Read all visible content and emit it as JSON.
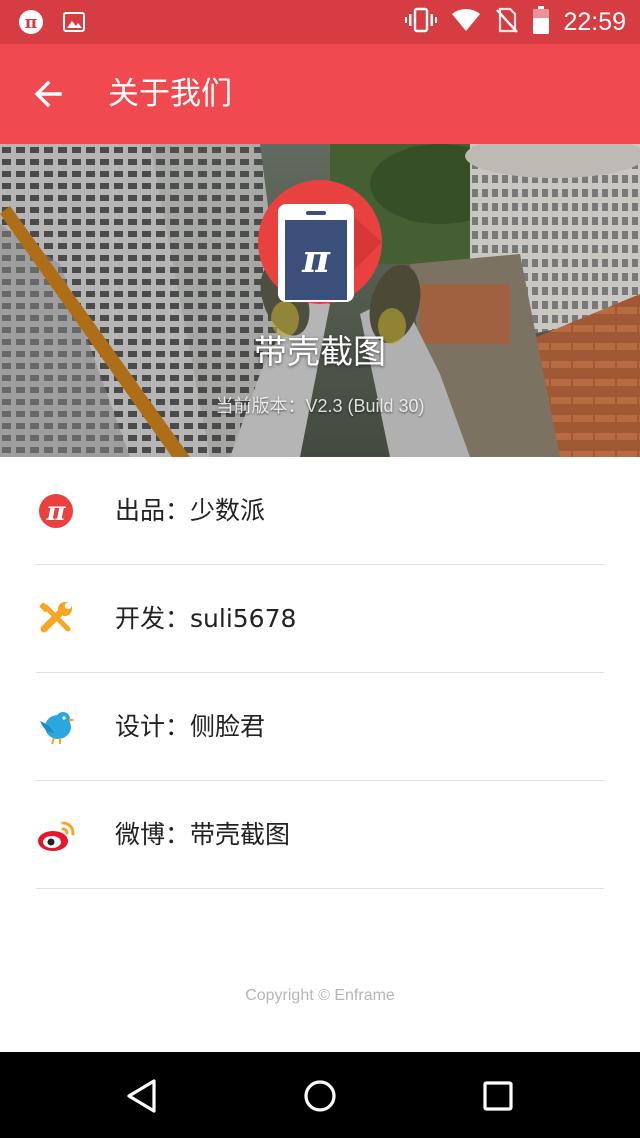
{
  "status_bar": {
    "time": "22:59",
    "icons": [
      "pi-app-icon",
      "image-icon",
      "vibrate-icon",
      "wifi-icon",
      "no-sim-icon",
      "battery-icon"
    ]
  },
  "app_bar": {
    "title": "关于我们",
    "back_icon": "arrow-left-icon"
  },
  "header": {
    "app_name": "带壳截图",
    "version": "当前版本：V2.3 (Build 30)"
  },
  "items": [
    {
      "icon": "pi-logo-icon",
      "text": "出品：少数派"
    },
    {
      "icon": "wrench-icon",
      "text": "开发：suli5678"
    },
    {
      "icon": "bird-icon",
      "text": "设计：侧脸君"
    },
    {
      "icon": "weibo-icon",
      "text": "微博：带壳截图"
    }
  ],
  "footer": {
    "copyright": "Copyright © Enframe"
  },
  "nav_bar": {
    "buttons": [
      "back-triangle-icon",
      "home-circle-icon",
      "recents-square-icon"
    ]
  },
  "colors": {
    "status_bar": "#d63d42",
    "app_bar": "#f04a50",
    "accent_red": "#e8413f",
    "wrench_orange": "#f5a623",
    "bird_blue": "#2aa6e0"
  }
}
